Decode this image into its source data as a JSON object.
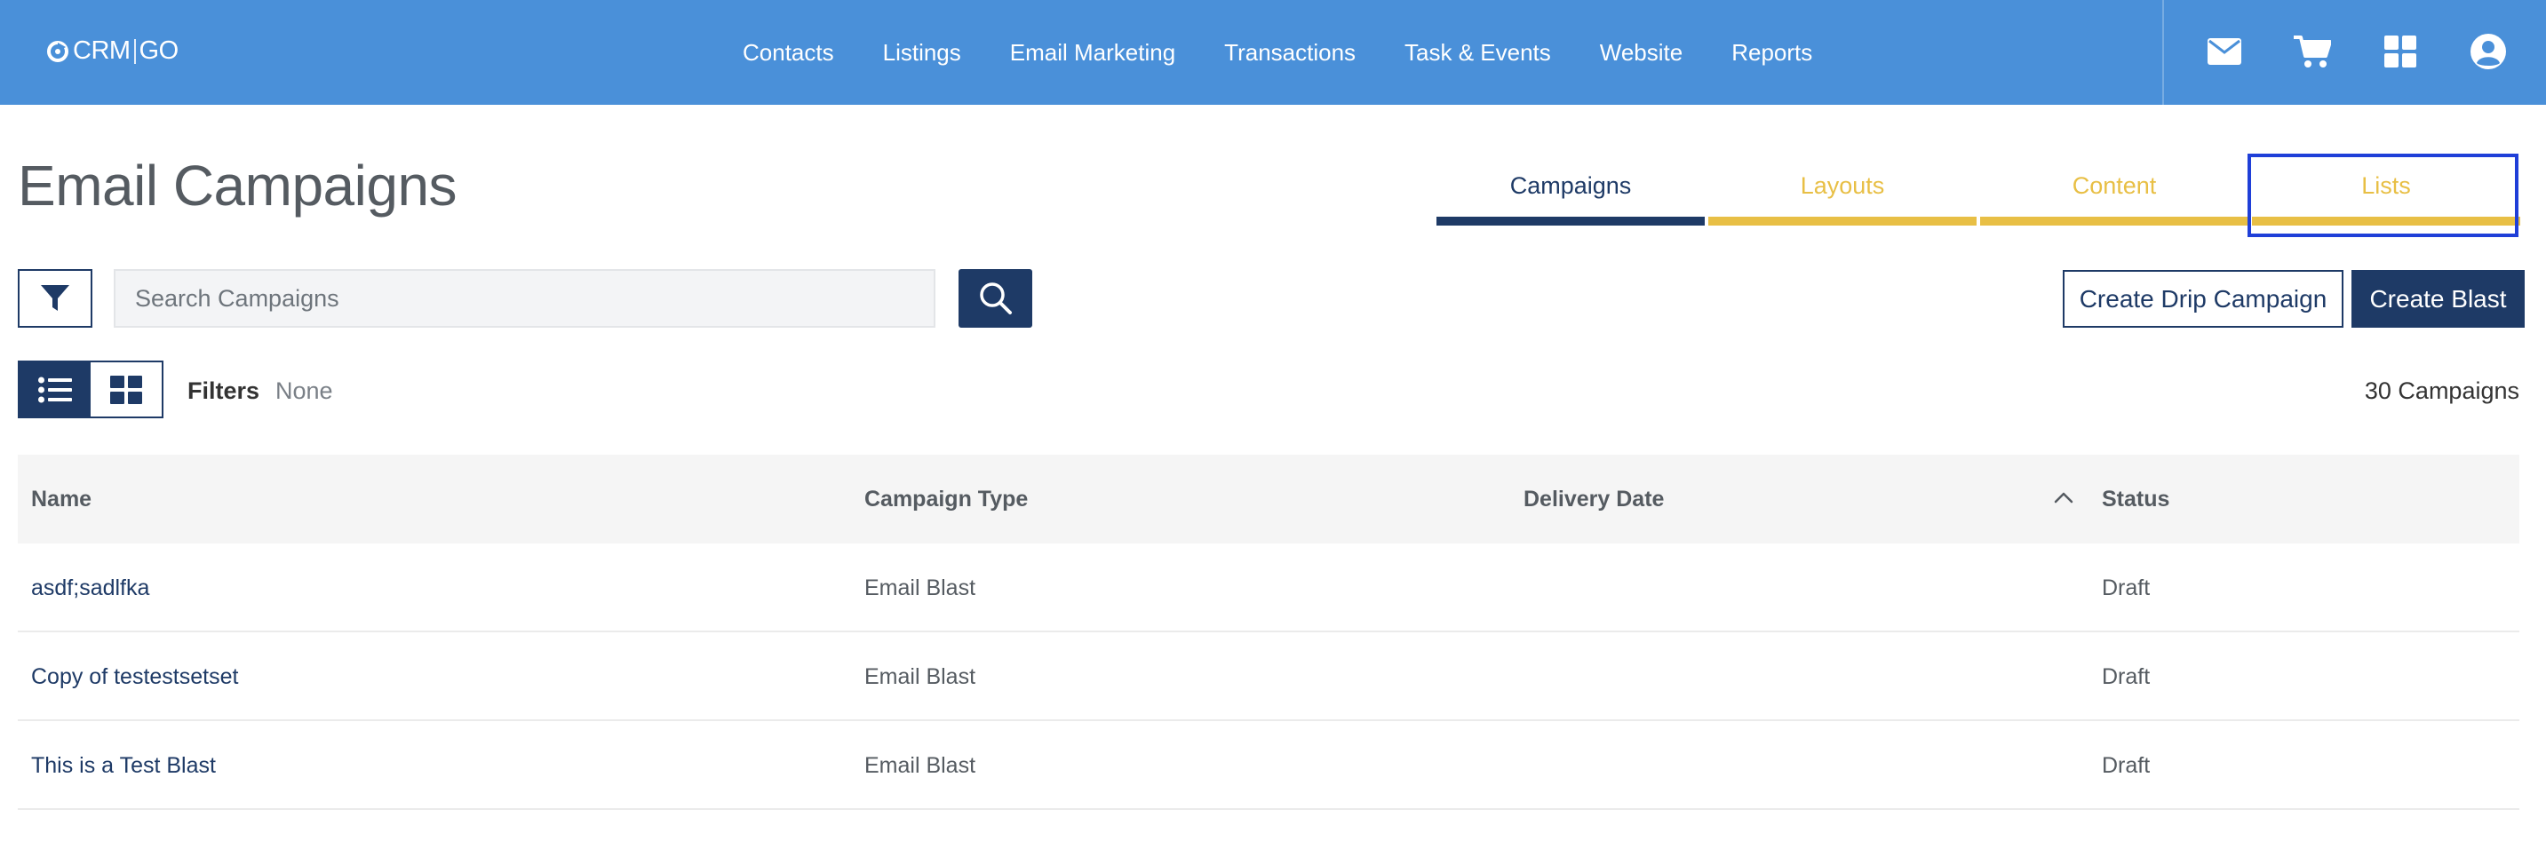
{
  "app": {
    "logo_text": "CRM",
    "logo_suffix": "GO"
  },
  "nav": {
    "items": [
      "Contacts",
      "Listings",
      "Email Marketing",
      "Transactions",
      "Task & Events",
      "Website",
      "Reports"
    ]
  },
  "header_icons": [
    "mail-icon",
    "cart-icon",
    "apps-grid-icon",
    "user-account-icon"
  ],
  "page": {
    "title": "Email Campaigns"
  },
  "tabs": [
    {
      "label": "Campaigns",
      "active": true
    },
    {
      "label": "Layouts",
      "active": false
    },
    {
      "label": "Content",
      "active": false
    },
    {
      "label": "Lists",
      "active": false
    }
  ],
  "search": {
    "placeholder": "Search Campaigns",
    "value": ""
  },
  "actions": {
    "drip_label": "Create Drip Campaign",
    "blast_label": "Create Blast"
  },
  "filters": {
    "label": "Filters",
    "value": "None"
  },
  "summary": {
    "count_label": "30 Campaigns"
  },
  "table": {
    "columns": [
      "Name",
      "Campaign Type",
      "Delivery Date",
      "Status"
    ],
    "sort_column": "Delivery Date",
    "rows": [
      {
        "name": "asdf;sadlfka",
        "type": "Email Blast",
        "date": "",
        "status": "Draft"
      },
      {
        "name": "Copy of testestsetset",
        "type": "Email Blast",
        "date": "",
        "status": "Draft"
      },
      {
        "name": "This is a Test Blast",
        "type": "Email Blast",
        "date": "",
        "status": "Draft"
      }
    ]
  },
  "colors": {
    "topbar": "#4a90d9",
    "primary": "#1e3a66",
    "tab_inactive": "#e8bf45",
    "focus_outline": "#1f3fd8"
  }
}
